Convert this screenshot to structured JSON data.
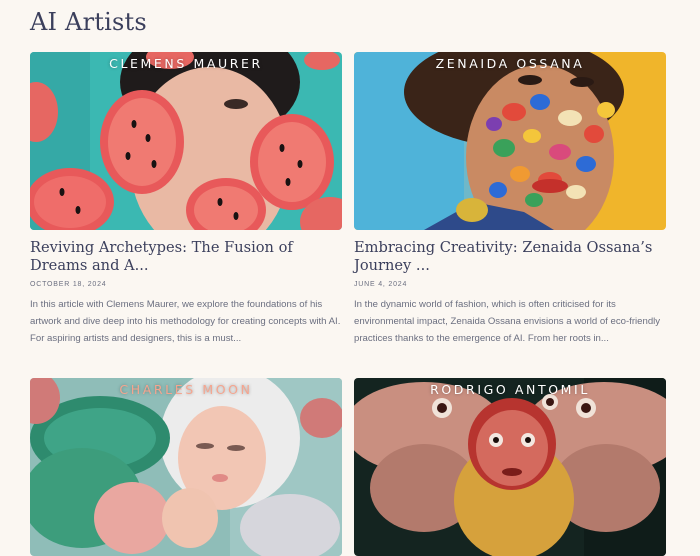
{
  "page": {
    "title": "AI Artists"
  },
  "cards": [
    {
      "artist": "CLEMENS MAURER",
      "title": "Reviving Archetypes: The Fusion of Dreams and A...",
      "date": "OCTOBER 18, 2024",
      "excerpt": "In this article with Clemens Maurer, we explore the foundations of his artwork and dive deep into his methodology for creating concepts with AI. For aspiring artists and designers, this is a must..."
    },
    {
      "artist": "ZENAIDA OSSANA",
      "title": "Embracing Creativity: Zenaida Ossana’s Journey ...",
      "date": "JUNE 4, 2024",
      "excerpt": "In the dynamic world of fashion, which is often criticised for its environmental impact, Zenaida Ossana envisions a world of eco-friendly practices thanks to the emergence of AI. From her roots in..."
    },
    {
      "artist": "CHARLES MOON",
      "title": "",
      "date": "",
      "excerpt": ""
    },
    {
      "artist": "RODRIGO ANTOMIL",
      "title": "",
      "date": "",
      "excerpt": ""
    }
  ],
  "colors": {
    "background": "#fbf7f2",
    "heading": "#3b3f5c",
    "muted": "#6b6f80",
    "label_white": "#ffffff",
    "label_salmon": "#f5a58f"
  }
}
